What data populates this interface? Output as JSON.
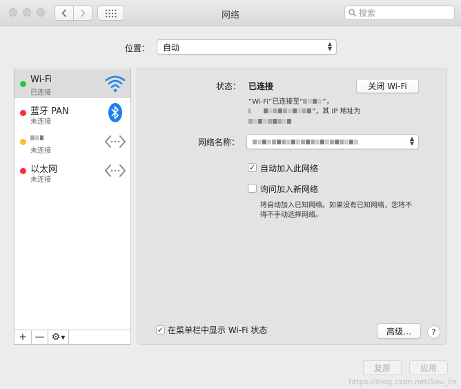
{
  "window": {
    "title": "网络",
    "search_placeholder": "搜索",
    "nav": {
      "back_icon": "chevron-left-icon",
      "forward_icon": "chevron-right-icon",
      "grid_icon": "grid-icon"
    },
    "traffic_light_color": "#cfcfcf"
  },
  "location": {
    "label": "位置：",
    "value": "自动"
  },
  "services": [
    {
      "name": "Wi-Fi",
      "status": "已连接",
      "status_color": "#28c840",
      "icon": "wifi-icon",
      "selected": true
    },
    {
      "name": "蓝牙 PAN",
      "status": "未连接",
      "status_color": "#ff2d3a",
      "icon": "bluetooth-icon"
    },
    {
      "name": "",
      "status": "未连接",
      "status_color": "#ffbd2e",
      "icon": "network-interface-icon"
    },
    {
      "name": "以太网",
      "status": "未连接",
      "status_color": "#ff2d3a",
      "icon": "network-interface-icon"
    }
  ],
  "toolbar": {
    "add": "+",
    "remove": "—",
    "gear": "⚙"
  },
  "detail": {
    "status_label": "状态：",
    "status_value": "已连接",
    "status_line1": "“Wi-Fi”已连接至“",
    "status_line1_end": "”，",
    "status_line2_end": "”，其 IP 地址为",
    "turn_off_label": "关闭 Wi-Fi",
    "network_name_label": "网络名称：",
    "auto_join_label": "自动加入此网络",
    "auto_join_checked": true,
    "ask_join_label": "询问加入新网络",
    "ask_join_checked": false,
    "ask_join_note_1": "将自动加入已知网络。如果没有已知网络，您将不",
    "ask_join_note_2": "得不手动选择网络。",
    "show_menubar_label": "在菜单栏中显示 Wi-Fi 状态",
    "show_menubar_checked": true,
    "advanced_label": "高级…",
    "help_label": "?"
  },
  "footer": {
    "revert_label": "复原",
    "apply_label": "应用"
  },
  "watermark": "https://blog.csdn.net/Sou_lin"
}
